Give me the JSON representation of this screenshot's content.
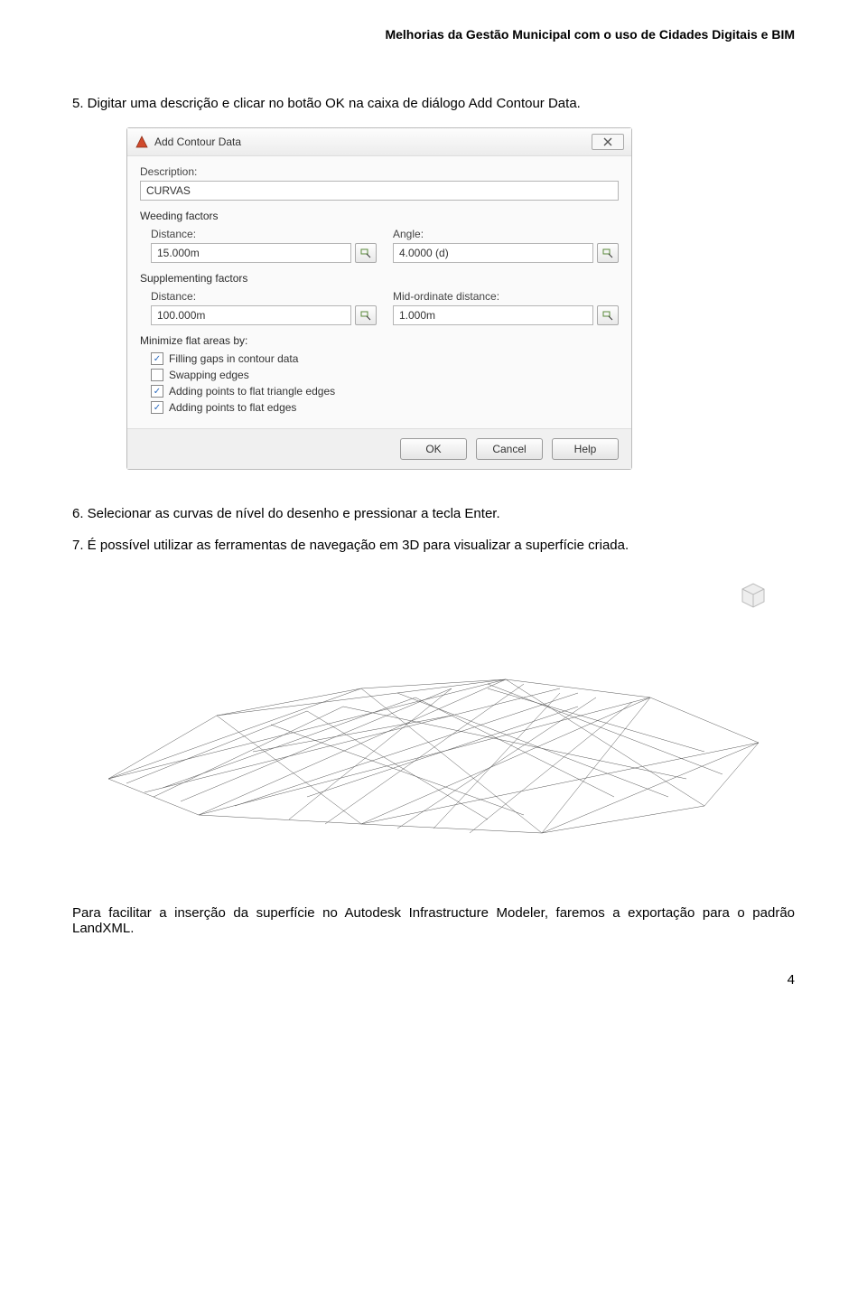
{
  "header": "Melhorias da Gestão Municipal com o uso de Cidades Digitais e BIM",
  "step5": "5.   Digitar uma descrição e clicar no botão OK na caixa de diálogo Add Contour Data.",
  "step6": "6.   Selecionar as curvas de nível do desenho e pressionar a tecla Enter.",
  "step7": "7.   É possível utilizar as ferramentas de navegação em 3D para visualizar a superfície criada.",
  "paragraphFinal": "Para facilitar a inserção da superfície no Autodesk Infrastructure Modeler, faremos a exportação para o padrão LandXML.",
  "pageNumber": "4",
  "dialog": {
    "title": "Add Contour Data",
    "labels": {
      "description": "Description:",
      "weeding": "Weeding factors",
      "distance": "Distance:",
      "angle": "Angle:",
      "supplementing": "Supplementing factors",
      "midOrd": "Mid-ordinate distance:",
      "minimize": "Minimize flat areas by:",
      "chkFill": "Filling gaps in contour data",
      "chkSwap": "Swapping edges",
      "chkTri": "Adding points to flat triangle edges",
      "chkFlat": "Adding points to flat edges"
    },
    "values": {
      "description": "CURVAS",
      "weedDistance": "15.000m",
      "weedAngle": "4.0000 (d)",
      "supDistance": "100.000m",
      "supMid": "1.000m"
    },
    "buttons": {
      "ok": "OK",
      "cancel": "Cancel",
      "help": "Help"
    },
    "checks": {
      "fill": true,
      "swap": false,
      "tri": true,
      "flat": true
    }
  }
}
